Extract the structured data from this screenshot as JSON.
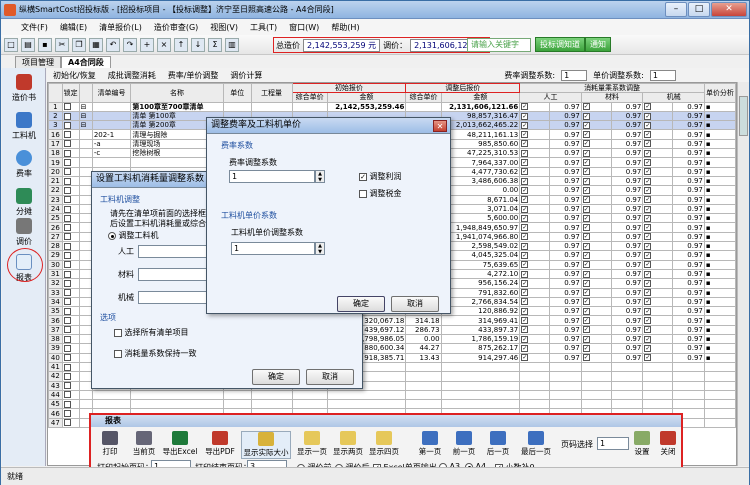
{
  "window": {
    "title": "纵横SmartCost招投标版 - [招投标项目 - 【投标调整】济宁至日照高速公路 - A4合同段]"
  },
  "menu": [
    "文件(F)",
    "编辑(E)",
    "清单报价(L)",
    "造价审查(G)",
    "视图(V)",
    "工具(T)",
    "窗口(W)",
    "帮助(H)"
  ],
  "toolbar": {
    "total_label": "总造价",
    "total_value": "2,142,553,259 元",
    "adjust_label": "调价：",
    "adjust_value": "2,131,606,122 元",
    "search_placeholder": "请输入关键字",
    "btn_newsletter": "投标调知道",
    "btn_more": "通知"
  },
  "tabs": [
    "项目管理",
    "A4合同段"
  ],
  "sidebar": [
    "造价书",
    "工料机",
    "费率",
    "分摊",
    "调价",
    "报表"
  ],
  "subtoolbar": {
    "items": [
      "初始化/恢复",
      "成批调整消耗",
      "费率/单价调整",
      "调价计算"
    ],
    "rate_label": "费率调整系数:",
    "rate_value": "1",
    "price_label": "单价调整系数:",
    "price_value": "1"
  },
  "grid": {
    "headers": {
      "lock": "锁定",
      "code": "清单编号",
      "name": "名称",
      "unit": "单位",
      "qty": "工程量",
      "init": "初始报价",
      "adj": "调整后报价",
      "price": "综合单价",
      "amount": "金额",
      "coef": "消耗量乘系数调整",
      "labor": "人工",
      "mat": "材料",
      "mach": "机械",
      "ana": "单价分析"
    },
    "rows": [
      {
        "n": "1",
        "code": "",
        "name": "第100章至700章清单",
        "unit": "",
        "qty": "",
        "p1": "",
        "a1": "2,142,553,259.46",
        "p2": "",
        "a2": "2,131,606,121.66",
        "c1": "0.97",
        "c2": "0.97",
        "c3": "0.97"
      },
      {
        "n": "2",
        "code": "",
        "name": "清单 第100章",
        "unit": "",
        "qty": "",
        "p1": "",
        "a1": "",
        "p2": "",
        "a2": "98,857,316.47",
        "c1": "0.97",
        "c2": "0.97",
        "c3": "0.97"
      },
      {
        "n": "3",
        "code": "",
        "name": "清单 第200章",
        "unit": "",
        "qty": "",
        "p1": "",
        "a1": "",
        "p2": "0.00",
        "a2": "2,013,662,465.22",
        "c1": "0.97",
        "c2": "0.97",
        "c3": "0.97"
      },
      {
        "n": "16",
        "code": "202-1",
        "name": "清理与掘除",
        "unit": "",
        "qty": "",
        "p1": "",
        "a1": "",
        "p2": "0.00",
        "a2": "48,211,161.13",
        "c1": "0.97",
        "c2": "0.97",
        "c3": "0.97"
      },
      {
        "n": "17",
        "code": "-a",
        "name": "清理现场",
        "unit": "",
        "qty": "",
        "p1": "",
        "a1": "",
        "p2": "4.90",
        "a2": "985,850.60",
        "c1": "0.97",
        "c2": "0.97",
        "c3": "0.97"
      },
      {
        "n": "18",
        "code": "-c",
        "name": "挖除树根",
        "unit": "",
        "qty": "",
        "p1": "",
        "a1": "12180.89",
        "p2": "",
        "a2": "47,225,310.53",
        "c1": "0.97",
        "c2": "0.97",
        "c3": "0.97"
      },
      {
        "n": "19",
        "code": "",
        "name": "",
        "unit": "",
        "qty": "",
        "p1": "",
        "a1": "",
        "p2": "0.00",
        "a2": "7,964,337.00",
        "c1": "0.97",
        "c2": "0.97",
        "c3": "0.97"
      },
      {
        "n": "20",
        "code": "",
        "name": "",
        "unit": "",
        "qty": "",
        "p1": "",
        "a1": "",
        "p2": "13.42",
        "a2": "4,477,730.62",
        "c1": "0.97",
        "c2": "0.97",
        "c3": "0.97"
      },
      {
        "n": "21",
        "code": "",
        "name": "",
        "unit": "",
        "qty": "",
        "p1": "",
        "a1": "",
        "p2": "16.42",
        "a2": "3,486,606.38",
        "c1": "0.97",
        "c2": "0.97",
        "c3": "0.97"
      },
      {
        "n": "22",
        "code": "",
        "name": "",
        "unit": "",
        "qty": "",
        "p1": "",
        "a1": "",
        "p2": "",
        "a2": "0.00",
        "c1": "0.97",
        "c2": "0.97",
        "c3": "0.97"
      },
      {
        "n": "23",
        "code": "",
        "name": "",
        "unit": "",
        "qty": "",
        "p1": "",
        "a1": "",
        "p2": "0.00",
        "a2": "8,671.04",
        "c1": "0.97",
        "c2": "0.97",
        "c3": "0.97"
      },
      {
        "n": "24",
        "code": "",
        "name": "",
        "unit": "",
        "qty": "",
        "p1": "",
        "a1": "",
        "p2": "9.14",
        "a2": "3,071.04",
        "c1": "0.97",
        "c2": "0.97",
        "c3": "0.97"
      },
      {
        "n": "25",
        "code": "",
        "name": "",
        "unit": "",
        "qty": "",
        "p1": "",
        "a1": "",
        "p2": "25.00",
        "a2": "5,600.00",
        "c1": "0.97",
        "c2": "0.97",
        "c3": "0.97"
      },
      {
        "n": "26",
        "code": "",
        "name": "",
        "unit": "",
        "qty": "",
        "p1": "",
        "a1": "",
        "p2": "0.00",
        "a2": "1,948,849,650.97",
        "c1": "0.97",
        "c2": "0.97",
        "c3": "0.97"
      },
      {
        "n": "27",
        "code": "",
        "name": "",
        "unit": "",
        "qty": "",
        "p1": "",
        "a1": "6452.72",
        "p2": "",
        "a2": "1,941,074,966.80",
        "c1": "0.97",
        "c2": "0.97",
        "c3": "0.97"
      },
      {
        "n": "28",
        "code": "",
        "name": "",
        "unit": "",
        "qty": "",
        "p1": "",
        "a1": "",
        "p2": "11.26",
        "a2": "2,598,549.02",
        "c1": "0.97",
        "c2": "0.97",
        "c3": "0.97"
      },
      {
        "n": "29",
        "code": "",
        "name": "",
        "unit": "",
        "qty": "",
        "p1": "",
        "a1": "",
        "p2": "16.44",
        "a2": "4,045,325.04",
        "c1": "0.97",
        "c2": "0.97",
        "c3": "0.97"
      },
      {
        "n": "30",
        "code": "",
        "name": "",
        "unit": "",
        "qty": "",
        "p1": "",
        "a1": "",
        "p2": "33.50",
        "a2": "75,639.65",
        "c1": "0.97",
        "c2": "0.97",
        "c3": "0.97"
      },
      {
        "n": "31",
        "code": "",
        "name": "",
        "unit": "",
        "qty": "",
        "p1": "",
        "a1": "",
        "p2": "35.00",
        "a2": "4,272.10",
        "c1": "0.97",
        "c2": "0.97",
        "c3": "0.97"
      },
      {
        "n": "32",
        "code": "",
        "name": "",
        "unit": "",
        "qty": "",
        "p1": "",
        "a1": "961,419.16",
        "p2": "127.00",
        "a2": "956,156.24",
        "c1": "0.97",
        "c2": "0.97",
        "c3": "0.97"
      },
      {
        "n": "33",
        "code": "",
        "name": "",
        "unit": "",
        "qty": "",
        "p1": "",
        "a1": "802,269.00",
        "p2": "338.00",
        "a2": "791,832.60",
        "c1": "0.97",
        "c2": "0.97",
        "c3": "0.97"
      },
      {
        "n": "34",
        "code": "",
        "name": "",
        "unit": "",
        "qty": "",
        "p1": "",
        "a1": "2,803,238.10",
        "p2": "337.46",
        "a2": "2,766,834.54",
        "c1": "0.97",
        "c2": "0.97",
        "c3": "0.97"
      },
      {
        "n": "35",
        "code": "",
        "name": "",
        "unit": "",
        "qty": "",
        "p1": "",
        "a1": "122,506.27",
        "p2": "342.65",
        "a2": "120,886.92",
        "c1": "0.97",
        "c2": "0.97",
        "c3": "0.97"
      },
      {
        "n": "36",
        "code": "",
        "name": "",
        "unit": "",
        "qty": "",
        "p1": "",
        "a1": "320,067.18",
        "p2": "314.18",
        "a2": "314,969.41",
        "c1": "0.97",
        "c2": "0.97",
        "c3": "0.97"
      },
      {
        "n": "37",
        "code": "",
        "name": "",
        "unit": "",
        "qty": "",
        "p1": "",
        "a1": "439,697.12",
        "p2": "286.73",
        "a2": "433,897.37",
        "c1": "0.97",
        "c2": "0.97",
        "c3": "0.97"
      },
      {
        "n": "38",
        "code": "",
        "name": "",
        "unit": "",
        "qty": "",
        "p1": "",
        "a1": "1,798,986.05",
        "p2": "0.00",
        "a2": "1,786,159.19",
        "c1": "0.97",
        "c2": "0.97",
        "c3": "0.97"
      },
      {
        "n": "39",
        "code": "-b",
        "name": "三维植被网护坡",
        "unit": "m²",
        "qty": "19771.000",
        "p1": "44.54",
        "a1": "880,600.34",
        "p2": "44.27",
        "a2": "875,262.17",
        "c1": "0.97",
        "c2": "0.97",
        "c3": "0.97"
      },
      {
        "n": "40",
        "code": "-c",
        "name": "客土喷播护坡",
        "unit": "m²",
        "qty": "68079.000",
        "p1": "13.49",
        "a1": "918,385.71",
        "p2": "13.43",
        "a2": "914,297.46",
        "c1": "0.97",
        "c2": "0.97",
        "c3": "0.97"
      },
      {
        "n": "41",
        "code": "",
        "name": "",
        "unit": "",
        "qty": "",
        "p1": "",
        "a1": "",
        "p2": "",
        "a2": "",
        "c1": "",
        "c2": "",
        "c3": ""
      },
      {
        "n": "42",
        "code": "",
        "name": "",
        "unit": "",
        "qty": "",
        "p1": "",
        "a1": "",
        "p2": "",
        "a2": "",
        "c1": "",
        "c2": "",
        "c3": ""
      },
      {
        "n": "43",
        "code": "",
        "name": "",
        "unit": "",
        "qty": "",
        "p1": "",
        "a1": "",
        "p2": "",
        "a2": "",
        "c1": "",
        "c2": "",
        "c3": ""
      },
      {
        "n": "44",
        "code": "",
        "name": "",
        "unit": "",
        "qty": "",
        "p1": "",
        "a1": "",
        "p2": "",
        "a2": "",
        "c1": "",
        "c2": "",
        "c3": ""
      },
      {
        "n": "45",
        "code": "",
        "name": "",
        "unit": "",
        "qty": "",
        "p1": "",
        "a1": "",
        "p2": "",
        "a2": "",
        "c1": "",
        "c2": "",
        "c3": ""
      },
      {
        "n": "46",
        "code": "",
        "name": "",
        "unit": "",
        "qty": "",
        "p1": "",
        "a1": "",
        "p2": "",
        "a2": "",
        "c1": "",
        "c2": "",
        "c3": ""
      },
      {
        "n": "47",
        "code": "",
        "name": "",
        "unit": "",
        "qty": "",
        "p1": "",
        "a1": "",
        "p2": "",
        "a2": "",
        "c1": "",
        "c2": "",
        "c3": ""
      }
    ]
  },
  "dialog_labor": {
    "title": "设置工料机消耗量调整系数",
    "group1": "工料机调整",
    "desc1": "请先在清单项前面的选择框",
    "desc2": "后设置工料机消耗量或综合",
    "radio": "调整工料机",
    "labor": "人工",
    "material": "材料",
    "machine": "机械",
    "group2": "选项",
    "opt1": "选择所有清单项目",
    "opt2": "消耗量系数保持一致",
    "ok": "确定",
    "cancel": "取消"
  },
  "dialog_rate": {
    "title": "调整费率及工料机单价",
    "group1": "费率系数",
    "rate_label": "费率调整系数",
    "rate_value": "1",
    "chk_profit": "调整利润",
    "chk_tax": "调整税金",
    "group2": "工料机单价系数",
    "price_label": "工料机单价调整系数",
    "price_value": "1",
    "ok": "确定",
    "cancel": "取消"
  },
  "report": {
    "title": "报表",
    "buttons": [
      "打印",
      "当前页",
      "导出Excel",
      "导出PDF",
      "显示实际大小",
      "显示一页",
      "显示两页",
      "显示四页",
      "第一页",
      "前一页",
      "后一页",
      "最后一页"
    ],
    "page_select_label": "页码选择",
    "page_select_value": "1",
    "btn_setup": "设置",
    "btn_close": "关闭",
    "print_start_label": "打印起始页码：",
    "print_start_value": "1",
    "print_end_label": "打印结束页码：",
    "print_end_value": "3",
    "radio_before": "调价前",
    "radio_after": "调价后",
    "chk_excel": "Excel单页输出",
    "radio_a3": "A3",
    "radio_a4": "A4",
    "chk_decimal": "小数补0"
  },
  "status": {
    "text": "就绪"
  }
}
